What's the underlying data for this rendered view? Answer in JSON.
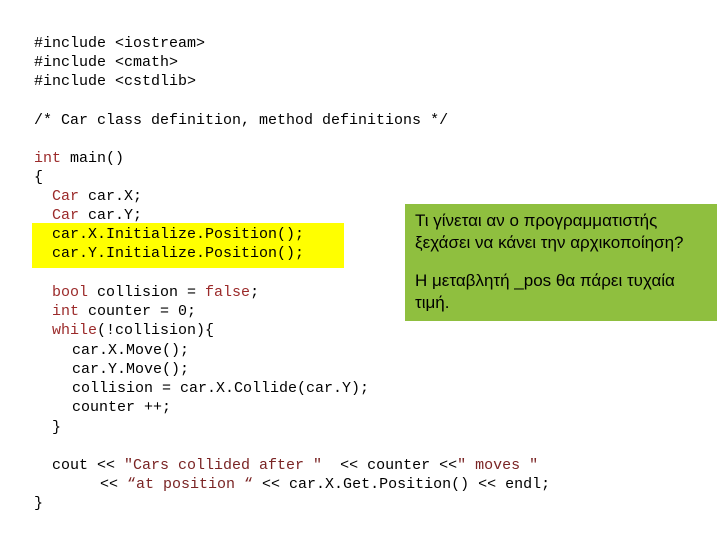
{
  "code": {
    "include1": "#include",
    "include1_file": "<iostream>",
    "include2": "#include",
    "include2_file": "<cmath>",
    "include3": "#include",
    "include3_file": "<cstdlib>",
    "comment": "/* Car class definition, method definitions */",
    "main_kw": "int",
    "main_rest": " main()",
    "open_brace": "{",
    "carx_kw": "Car",
    "carx_rest": " car.X;",
    "cary_kw": "Car",
    "cary_rest": " car.Y;",
    "initx": "car.X.Initialize.Position();",
    "inity": "car.Y.Initialize.Position();",
    "bool_kw": "bool",
    "bool_mid": " collision = ",
    "bool_false": "false",
    "bool_end": ";",
    "int_kw": "int",
    "int_rest": " counter = 0;",
    "while_kw": "while",
    "while_rest": "(!collision){",
    "movex": "car.X.Move();",
    "movey": "car.Y.Move();",
    "collide": "collision = car.X.Collide(car.Y);",
    "incr": "counter ++;",
    "close_inner": "}",
    "cout_a": "cout << ",
    "cout_str1": "\"Cars collided after \"",
    "cout_b": "  << counter <<",
    "cout_str2": "\" moves \"",
    "cout2_a": "<< ",
    "cout2_str": "“at position “",
    "cout2_b": " << car.X.Get.Position() << endl;",
    "close_outer": "}"
  },
  "notes": {
    "question": "Τι γίνεται αν ο προγραμματιστής ξεχάσει να κάνει την αρχικοποίηση?",
    "answer": "Η μεταβλητή _pos θα πάρει τυχαία τιμή."
  },
  "colors": {
    "highlight": "#ffff00",
    "note_bg": "#8fbf3f",
    "keyword": "#9b2a2a"
  }
}
